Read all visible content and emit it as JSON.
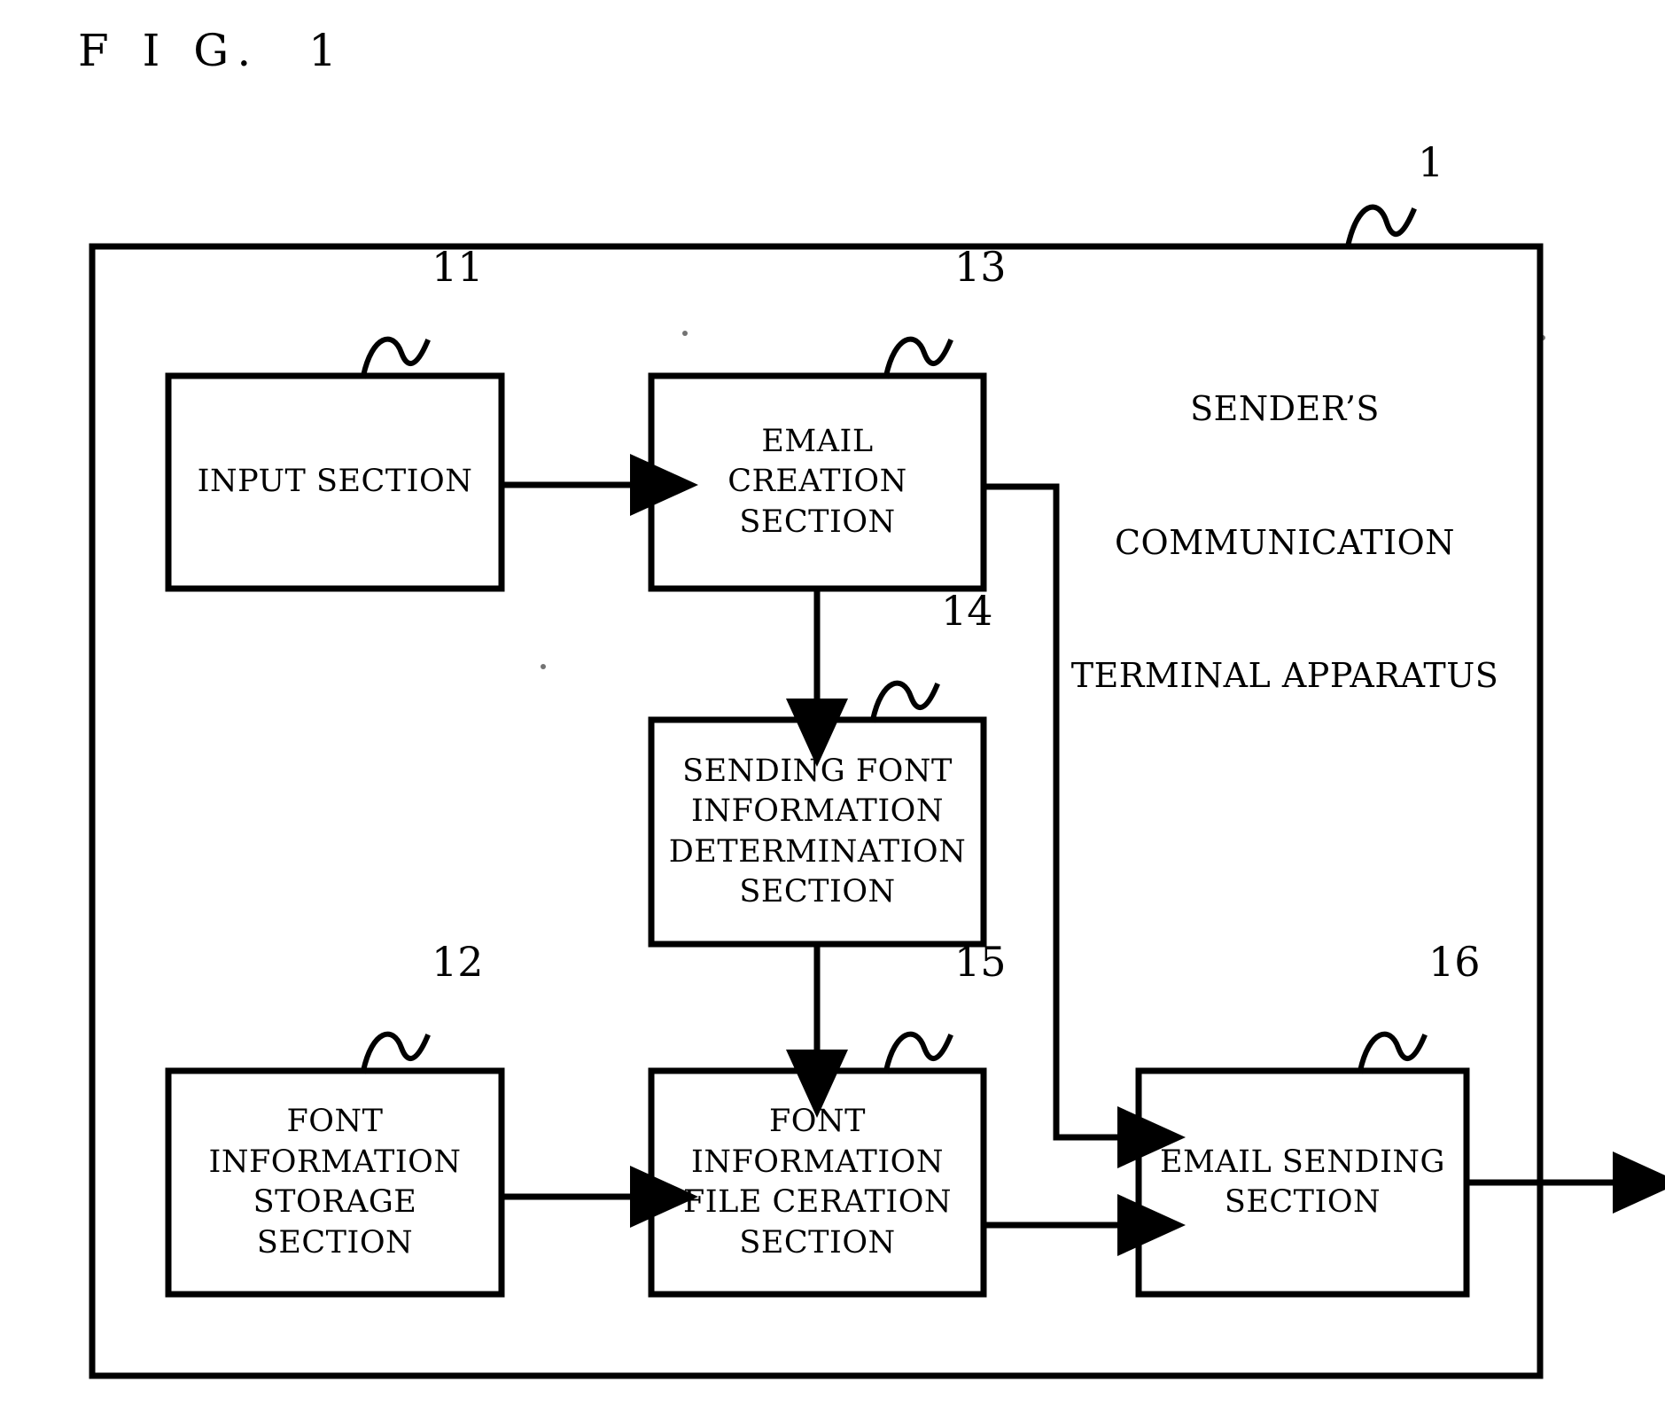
{
  "figure": {
    "title": "F I G.  1",
    "outer_frame_ref": "1",
    "apparatus_label": {
      "lines": [
        "SENDER’S",
        "COMMUNICATION",
        "TERMINAL APPARATUS"
      ]
    }
  },
  "blocks": [
    {
      "ref": "11",
      "name": "input-section",
      "lines": [
        "INPUT SECTION"
      ]
    },
    {
      "ref": "13",
      "name": "email-creation-section",
      "lines": [
        "EMAIL",
        "CREATION",
        "SECTION"
      ]
    },
    {
      "ref": "14",
      "name": "sending-font-information-determination-section",
      "lines": [
        "SENDING FONT",
        "INFORMATION",
        "DETERMINATION",
        "SECTION"
      ]
    },
    {
      "ref": "12",
      "name": "font-information-storage-section",
      "lines": [
        "FONT",
        "INFORMATION",
        "STORAGE",
        "SECTION"
      ]
    },
    {
      "ref": "15",
      "name": "font-information-file-ceration-section",
      "lines": [
        "FONT",
        "INFORMATION",
        "FILE CERATION",
        "SECTION"
      ]
    },
    {
      "ref": "16",
      "name": "email-sending-section",
      "lines": [
        "EMAIL SENDING",
        "SECTION"
      ]
    }
  ],
  "colors": {
    "ink": "#000000",
    "paper": "#ffffff"
  },
  "chart_data": {
    "type": "diagram",
    "title": "F I G.  1",
    "nodes": [
      {
        "id": "11",
        "label": "INPUT SECTION"
      },
      {
        "id": "13",
        "label": "EMAIL CREATION SECTION"
      },
      {
        "id": "14",
        "label": "SENDING FONT INFORMATION DETERMINATION SECTION"
      },
      {
        "id": "12",
        "label": "FONT INFORMATION STORAGE SECTION"
      },
      {
        "id": "15",
        "label": "FONT INFORMATION FILE CERATION SECTION"
      },
      {
        "id": "16",
        "label": "EMAIL SENDING SECTION"
      },
      {
        "id": "1",
        "label": "SENDER’S COMMUNICATION TERMINAL APPARATUS"
      }
    ],
    "edges": [
      {
        "from": "11",
        "to": "13"
      },
      {
        "from": "13",
        "to": "14"
      },
      {
        "from": "13",
        "to": "16"
      },
      {
        "from": "14",
        "to": "15"
      },
      {
        "from": "12",
        "to": "15"
      },
      {
        "from": "15",
        "to": "16"
      },
      {
        "from": "16",
        "to": "out"
      }
    ]
  }
}
